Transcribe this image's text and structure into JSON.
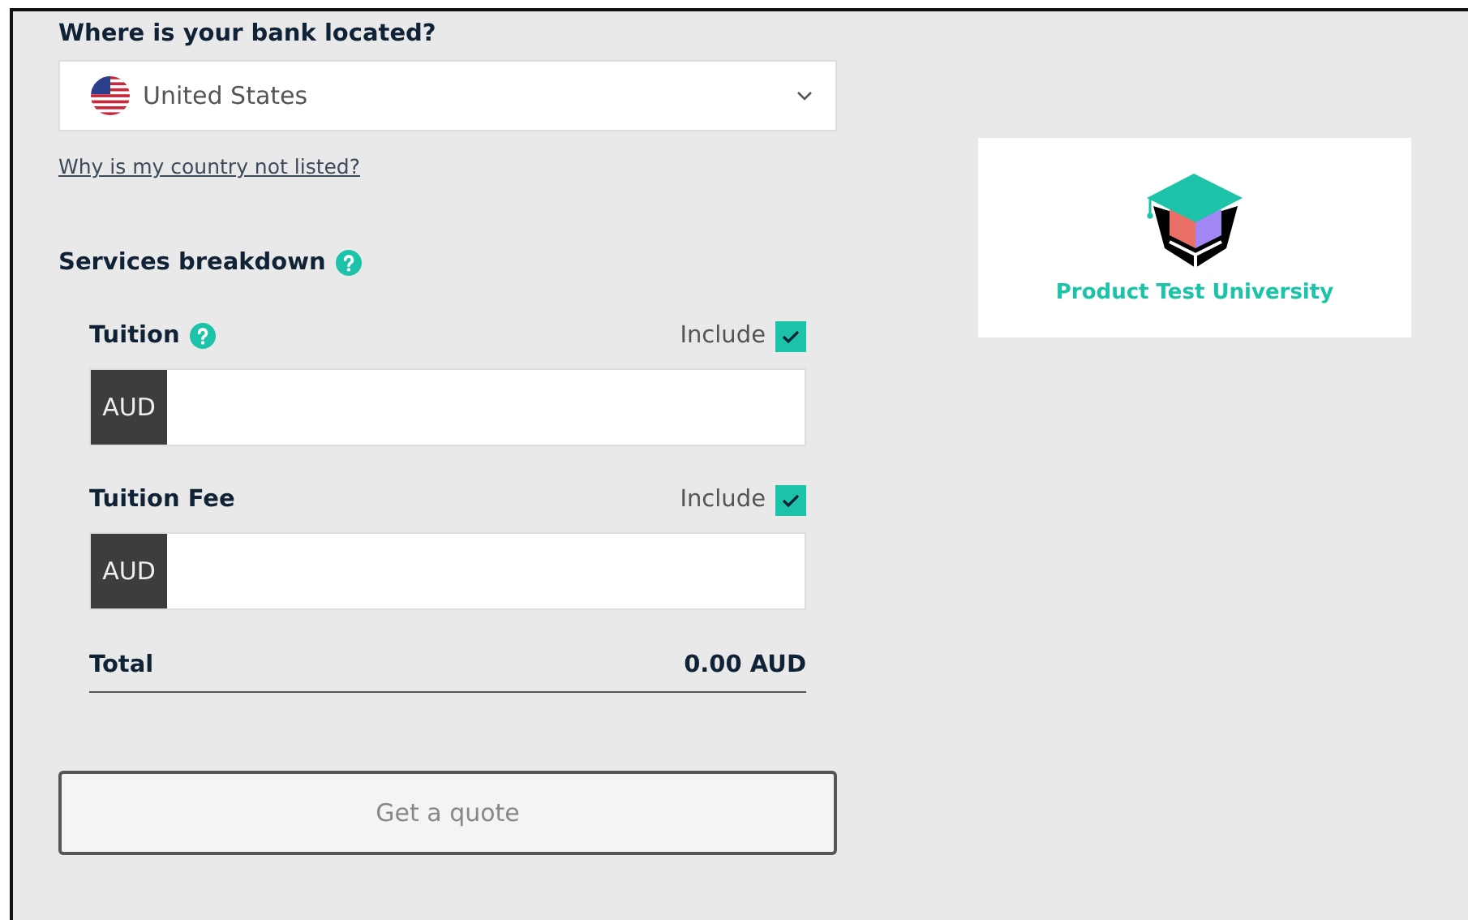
{
  "bank_location": {
    "label": "Where is your bank located?",
    "country": "United States",
    "link": "Why is my country not listed?"
  },
  "services": {
    "title": "Services breakdown",
    "items": [
      {
        "label": "Tuition",
        "help": true,
        "include_label": "Include",
        "checked": true,
        "currency": "AUD"
      },
      {
        "label": "Tuition Fee",
        "help": false,
        "include_label": "Include",
        "checked": true,
        "currency": "AUD"
      }
    ],
    "total_label": "Total",
    "total_value": "0.00 AUD"
  },
  "quote_button": {
    "label": "Get a quote",
    "disabled": true
  },
  "university": {
    "name": "Product Test University"
  }
}
